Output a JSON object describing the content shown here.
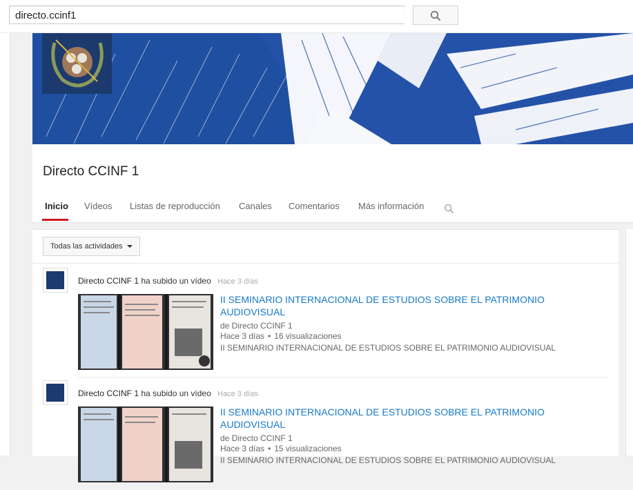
{
  "search": {
    "value": "directo.ccinf1"
  },
  "channel": {
    "name": "Directo CCINF 1",
    "tabs": [
      "Inicio",
      "Vídeos",
      "Listas de reproducción",
      "Canales",
      "Comentarios",
      "Más información"
    ],
    "active_tab": "Inicio"
  },
  "feed": {
    "filter_label": "Todas las actividades",
    "items": [
      {
        "user": "Directo CCINF 1",
        "action": "ha subido un vídeo",
        "time": "Hace 3 días",
        "title": "II SEMINARIO INTERNACIONAL DE ESTUDIOS SOBRE EL PATRIMONIO AUDIOVISUAL",
        "by": "de Directo CCINF 1",
        "age": "Hace 3 días",
        "views": "16 visualizaciones",
        "description": "II SEMINARIO INTERNACIONAL DE ESTUDIOS SOBRE EL PATRIMONIO AUDIOVISUAL"
      },
      {
        "user": "Directo CCINF 1",
        "action": "ha subido un vídeo",
        "time": "Hace 3 días",
        "title": "II SEMINARIO INTERNACIONAL DE ESTUDIOS SOBRE EL PATRIMONIO AUDIOVISUAL",
        "by": "de Directo CCINF 1",
        "age": "Hace 3 días",
        "views": "15 visualizaciones",
        "description": "II SEMINARIO INTERNACIONAL DE ESTUDIOS SOBRE EL PATRIMONIO AUDIOVISUAL"
      }
    ]
  },
  "colors": {
    "accent": "#cc181e",
    "link": "#167ac6",
    "banner_blue": "#1f4fa0"
  },
  "icons": [
    "search-icon",
    "channel-logo",
    "caret-down-icon",
    "clock-icon"
  ]
}
